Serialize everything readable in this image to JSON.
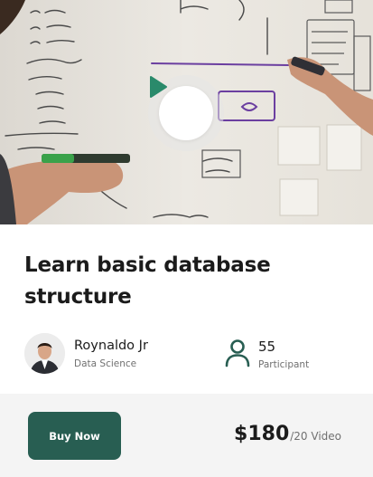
{
  "course": {
    "title": "Learn basic database structure"
  },
  "author": {
    "name": "Roynaldo Jr",
    "role": "Data Science"
  },
  "stats": {
    "participants_count": "55",
    "participants_label": "Participant"
  },
  "footer": {
    "buy_label": "Buy Now",
    "price": "$180",
    "price_unit": "/20 Video"
  },
  "colors": {
    "accent": "#285e52",
    "play_icon": "#2a8a6b",
    "footer_bg": "#f4f4f4"
  },
  "icons": {
    "play": "play-icon",
    "participant": "user-icon"
  }
}
